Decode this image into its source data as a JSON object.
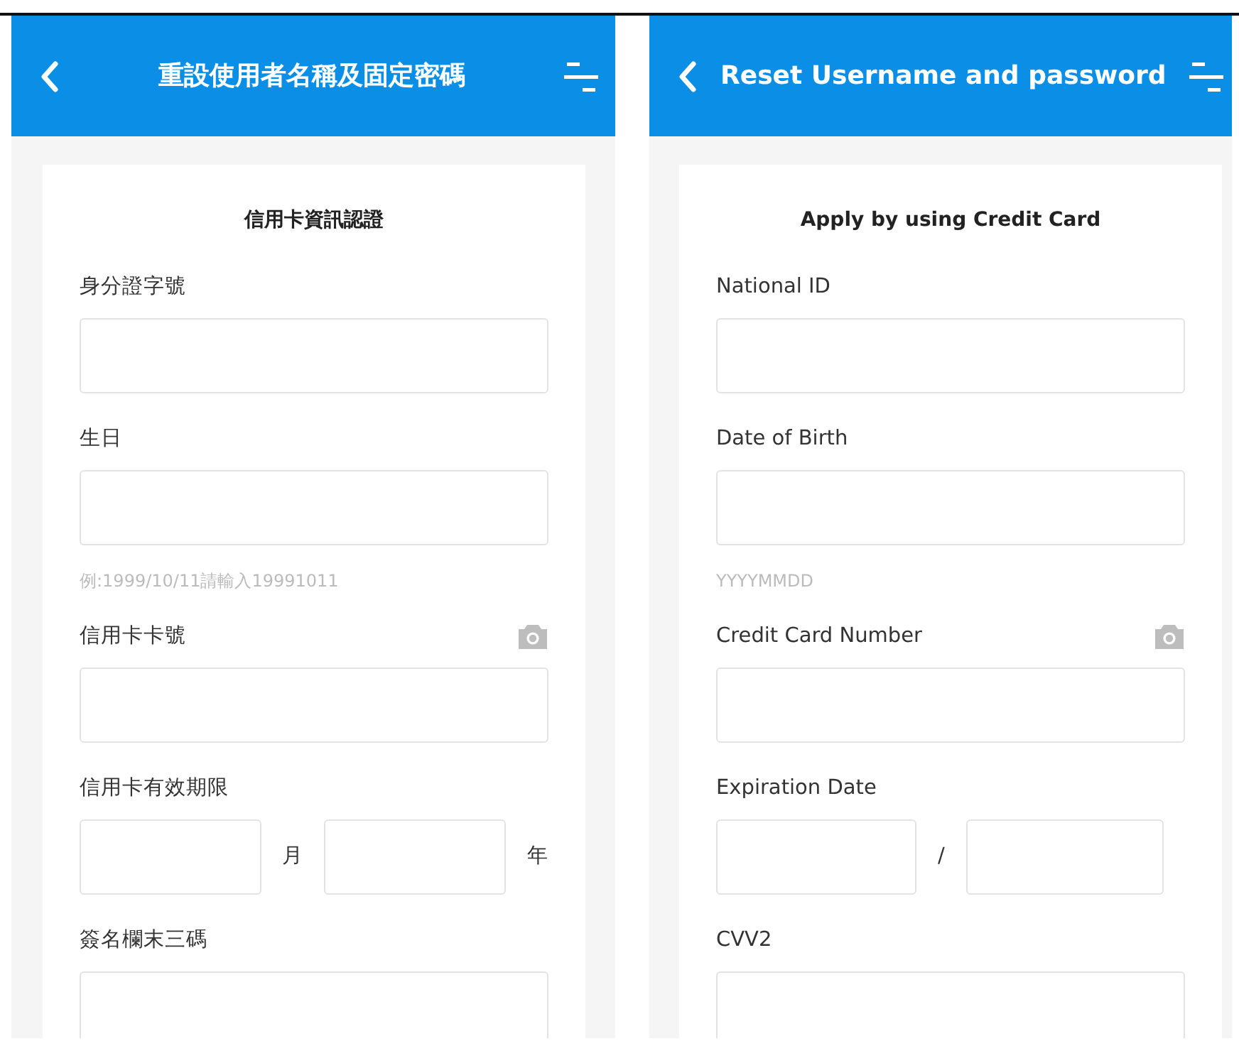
{
  "screens": [
    {
      "title": "重設使用者名稱及固定密碼",
      "card_title": "信用卡資訊認證",
      "fields": [
        {
          "kind": "text",
          "label": "身分證字號",
          "camera": false
        },
        {
          "kind": "text",
          "label": "生日",
          "camera": false,
          "hint": "例:1999/10/11請輸入19991011"
        },
        {
          "kind": "text",
          "label": "信用卡卡號",
          "camera": true
        },
        {
          "kind": "pair",
          "label": "信用卡有效期限",
          "separator": "月",
          "suffix": "年"
        },
        {
          "kind": "text",
          "label": "簽名欄末三碼",
          "camera": false
        }
      ]
    },
    {
      "title": "Reset Username and password",
      "card_title": "Apply by using Credit Card",
      "fields": [
        {
          "kind": "text",
          "label": "National ID",
          "camera": false
        },
        {
          "kind": "text",
          "label": "Date of Birth",
          "camera": false,
          "hint": "YYYYMMDD"
        },
        {
          "kind": "text",
          "label": "Credit Card Number",
          "camera": true
        },
        {
          "kind": "pair",
          "label": "Expiration Date",
          "separator": "/"
        },
        {
          "kind": "text",
          "label": "CVV2",
          "camera": false
        }
      ]
    }
  ]
}
